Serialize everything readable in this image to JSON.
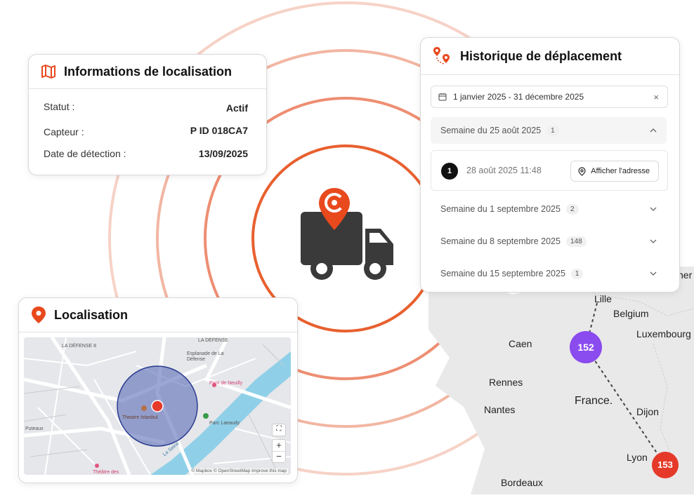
{
  "colors": {
    "accent": "#e8491d",
    "cluster_purple": "#8a4bef",
    "cluster_red": "#e53a2a",
    "truck": "#3a3a3a"
  },
  "info_card": {
    "icon": "map-icon",
    "title": "Informations de localisation",
    "rows": [
      {
        "label": "Statut :",
        "value": "Actif"
      },
      {
        "label": "Capteur :",
        "value": "P ID 018CA7"
      },
      {
        "label": "Date de détection :",
        "value": "13/09/2025"
      }
    ]
  },
  "history_card": {
    "icon": "route-pin-icon",
    "title": "Historique de déplacement",
    "date_range": "1 janvier 2025 - 31 décembre 2025",
    "weeks": [
      {
        "label": "Semaine du 25 août 2025",
        "count": "1",
        "expanded": true
      },
      {
        "label": "Semaine du 1 septembre 2025",
        "count": "2",
        "expanded": false
      },
      {
        "label": "Semaine du 8 septembre 2025",
        "count": "148",
        "expanded": false
      },
      {
        "label": "Semaine du 15 septembre 2025",
        "count": "1",
        "expanded": false
      }
    ],
    "entry": {
      "index": "1",
      "time": "28 août 2025 11:48",
      "button": "Afficher l'adresse"
    }
  },
  "loc_card": {
    "icon": "location-pin-icon",
    "title": "Localisation",
    "map_labels": {
      "defense": "LA DÉFENSE 8",
      "defense2": "LA DÉFENSE",
      "esplanade": "Esplanade de La Défense",
      "pont": "Pont de Neuilly",
      "parc": "Parc Laeaudy",
      "poi": "Theatre Istanbul",
      "puteaux": "Puteaux",
      "theatre": "Théâtre des",
      "seine": "La Seine"
    },
    "zoom_in": "+",
    "zoom_out": "−",
    "attribution": "© Mapbox © OpenStreetMap  Improve this map"
  },
  "europe_map": {
    "cities": {
      "lille": "Lille",
      "belgium": "Belgium",
      "luxembourg": "Luxembourg",
      "caen": "Caen",
      "rennes": "Rennes",
      "france": "France.",
      "nantes": "Nantes",
      "dijon": "Dijon",
      "lyon": "Lyon",
      "bordeaux": "Bordeaux",
      "partial": "her"
    },
    "clusters": [
      {
        "label": "152",
        "color": "#8a4bef"
      },
      {
        "label": "153",
        "color": "#e53a2a"
      }
    ]
  }
}
